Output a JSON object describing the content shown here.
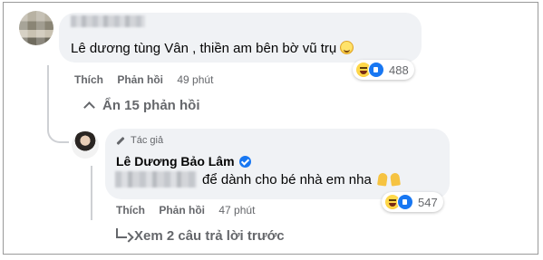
{
  "comment1": {
    "text": "Lê dương tùng Vân , thiền am bên bờ vũ trụ",
    "emoji": "grinning-face",
    "reaction_count": "488",
    "actions": {
      "like": "Thích",
      "reply": "Phản hồi",
      "time": "49 phút"
    }
  },
  "hide_replies": "Ẩn 15 phản hồi",
  "reply1": {
    "author_badge": "Tác giả",
    "author_name": "Lê Dương Bảo Lâm",
    "text": "để dành cho bé nhà em nha",
    "reaction_count": "547",
    "actions": {
      "like": "Thích",
      "reply": "Phản hồi",
      "time": "47 phút"
    }
  },
  "see_previous": "Xem 2 câu trả lời trước",
  "colors": {
    "bubble": "#f0f2f5",
    "meta": "#65676b",
    "like_blue": "#1877f2"
  }
}
